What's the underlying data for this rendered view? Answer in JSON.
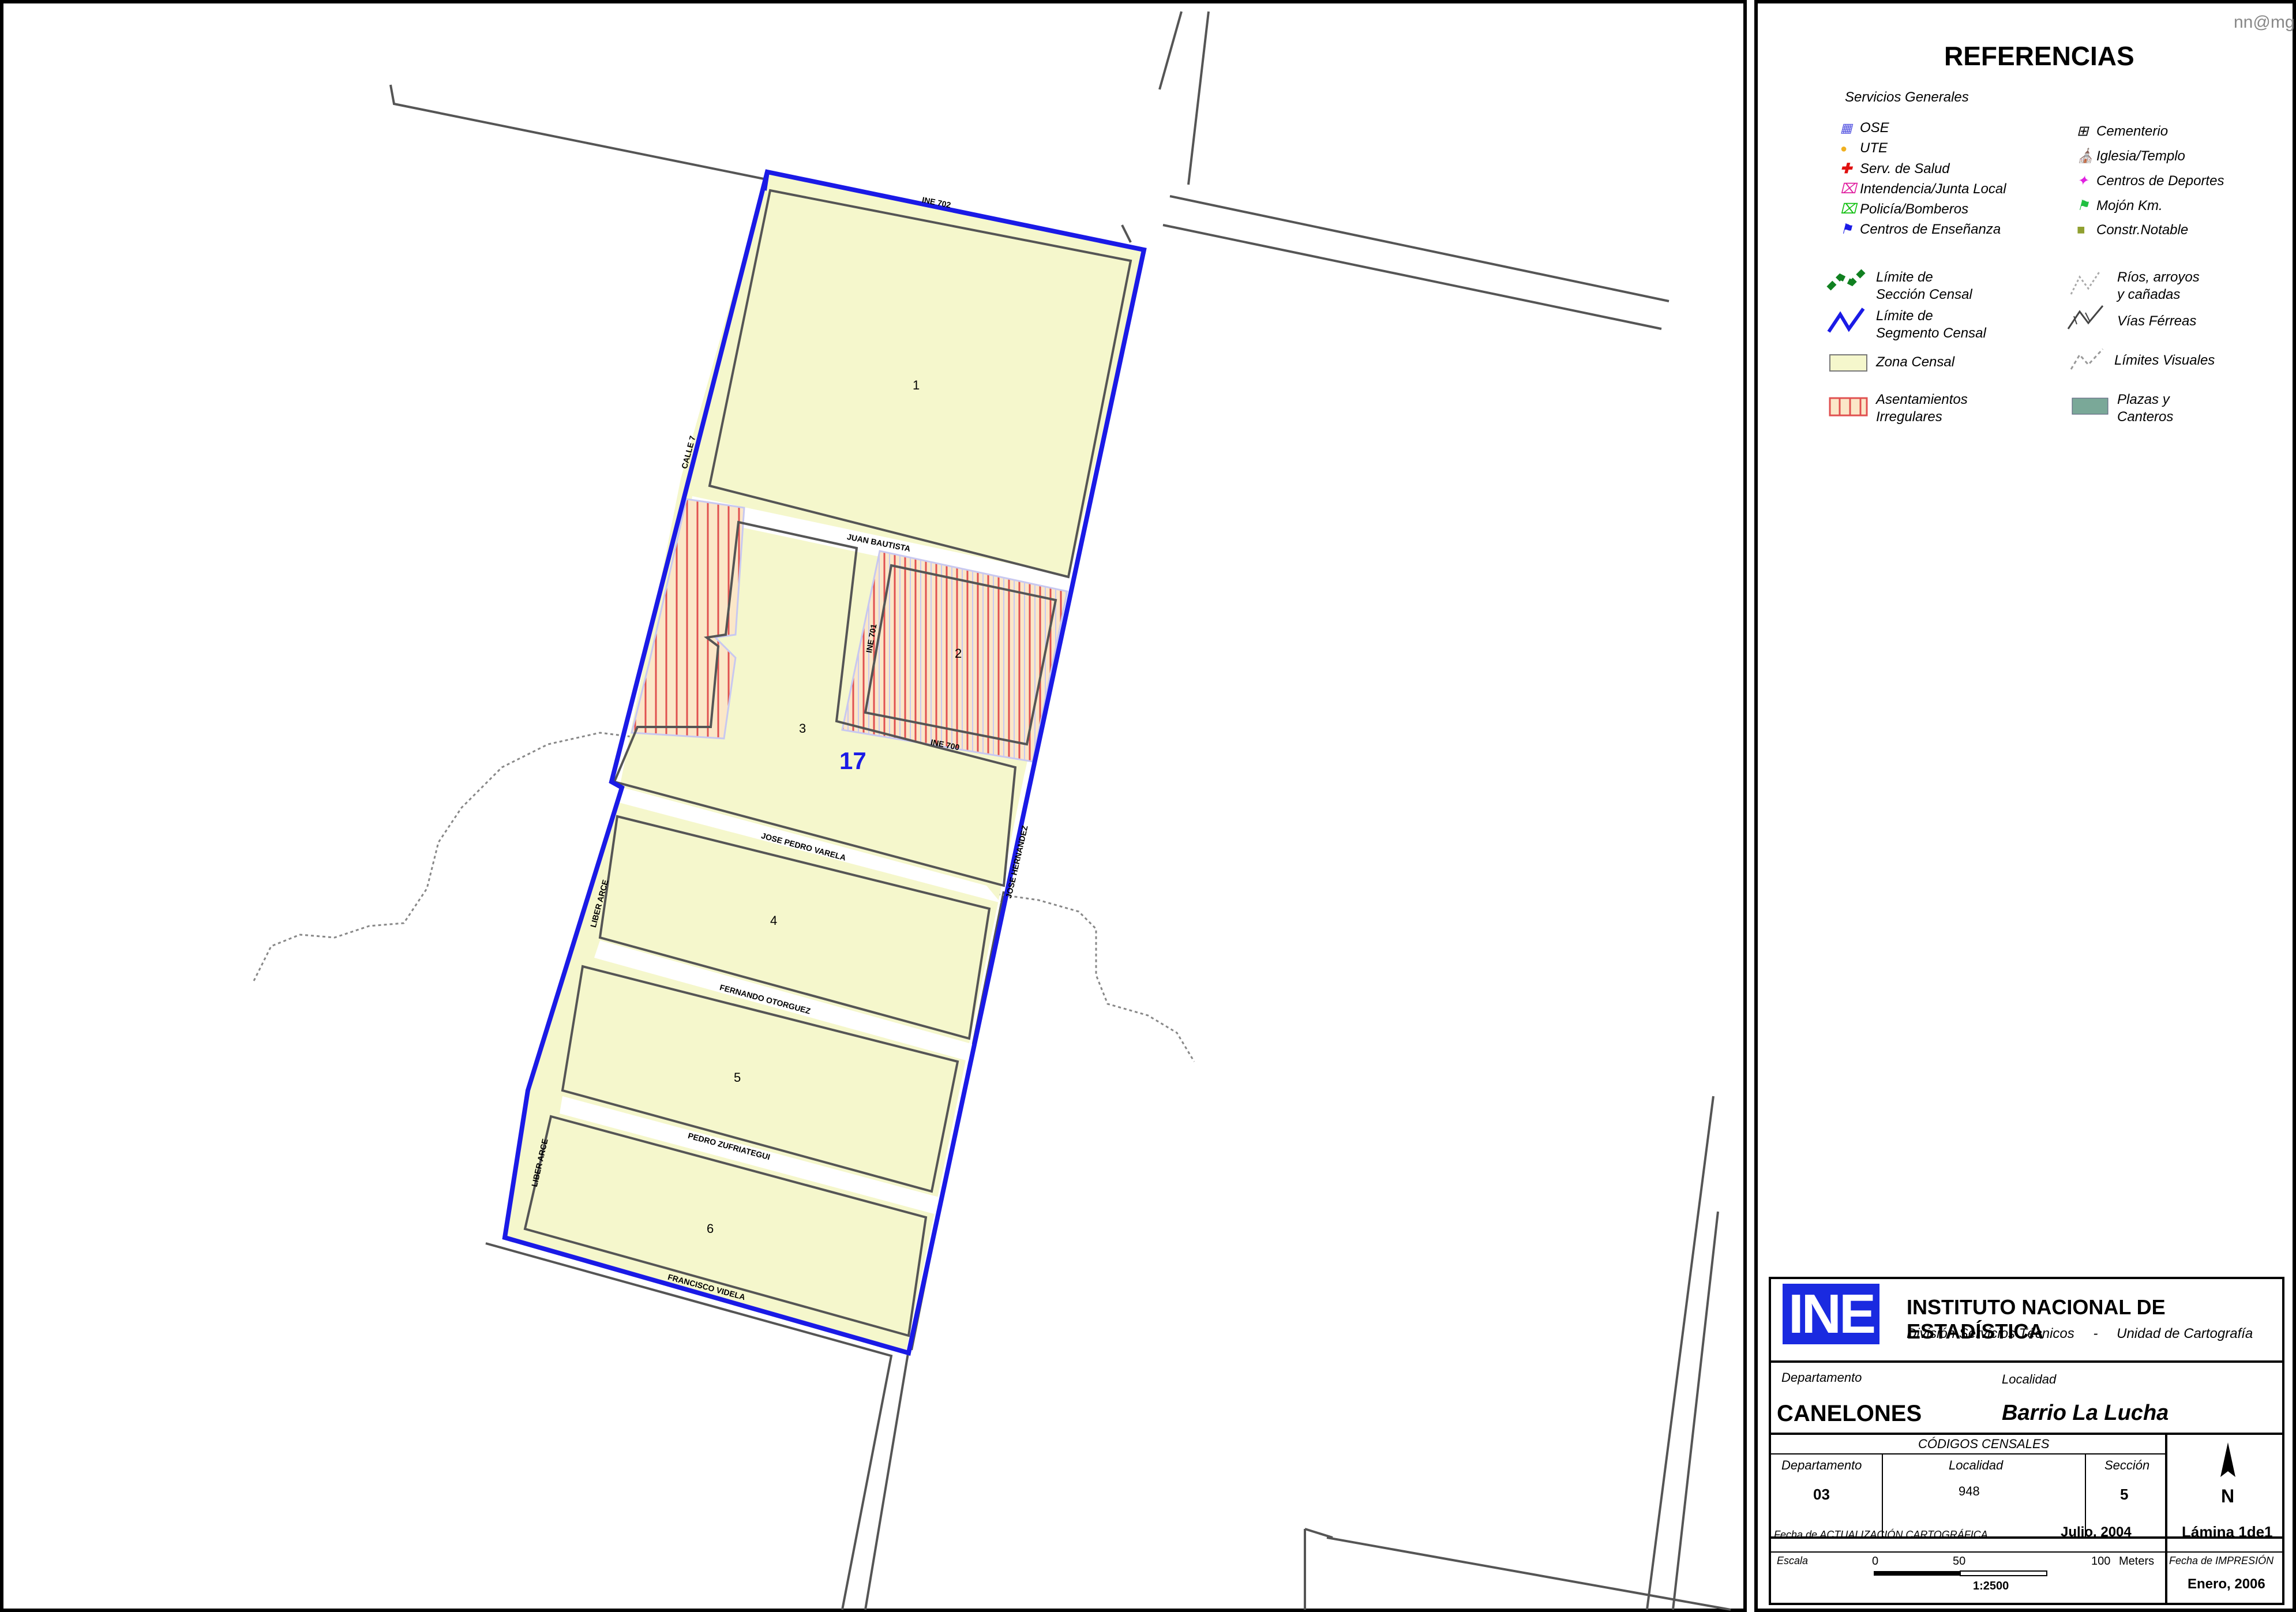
{
  "signature": "nn@mg",
  "map": {
    "segment_number": "17",
    "zones": [
      {
        "id": "1",
        "label": "1"
      },
      {
        "id": "2",
        "label": "2"
      },
      {
        "id": "3",
        "label": "3"
      },
      {
        "id": "4",
        "label": "4"
      },
      {
        "id": "5",
        "label": "5"
      },
      {
        "id": "6",
        "label": "6"
      }
    ],
    "streets": {
      "ine702": "INE 702",
      "calle7": "CALLE 7",
      "juan_bautista": "JUAN BAUTISTA",
      "ine701": "INE 701",
      "ine700": "INE 700",
      "jose_hernandez": "JOSE HERNANDEZ",
      "jose_pedro_varela": "JOSE PEDRO VARELA",
      "liber_arce_1": "LIBER ARCE",
      "fernando_otorguez": "FERNANDO OTORGUEZ",
      "pedro_zufriategui": "PEDRO ZUFRIATEGUI",
      "liber_arce_2": "LIBER ARCE",
      "francisco_videla": "FRANCISCO VIDELA"
    },
    "colors": {
      "zone_fill": "#f5f7cc",
      "segment_boundary": "#1a1ae6",
      "street_line": "#555555",
      "irregular_hatch": "#e05050",
      "river": "#888888"
    }
  },
  "legend": {
    "title": "REFERENCIAS",
    "services_heading": "Servicios Generales",
    "services_left": [
      "OSE",
      "UTE",
      "Serv. de Salud",
      "Intendencia/Junta Local",
      "Policía/Bomberos",
      "Centros de Enseñanza"
    ],
    "services_right": [
      "Cementerio",
      "Iglesia/Templo",
      "Centros de Deportes",
      "Mojón Km.",
      "Constr.Notable"
    ],
    "items_left": [
      {
        "line1": "Límite de",
        "line2": "Sección Censal"
      },
      {
        "line1": "Límite de",
        "line2": "Segmento Censal"
      },
      {
        "line1": "Zona Censal",
        "line2": ""
      },
      {
        "line1": "Asentamientos",
        "line2": "Irregulares"
      }
    ],
    "items_right": [
      {
        "line1": "Ríos, arroyos",
        "line2": "y cañadas"
      },
      {
        "line1": "Vías Férreas",
        "line2": ""
      },
      {
        "line1": "Límites  Visuales",
        "line2": ""
      },
      {
        "line1": "Plazas y",
        "line2": "Canteros"
      }
    ]
  },
  "titleblock": {
    "logo": "INE",
    "institute": "INSTITUTO NACIONAL DE ESTADÍSTICA",
    "division": "División Servicios Técnicos",
    "separator": "-",
    "unit": "Unidad de Cartografía",
    "dept_label": "Departamento",
    "locality_label": "Localidad",
    "dept_value": "CANELONES",
    "locality_value": "Barrio La Lucha",
    "codes_title": "CÓDIGOS CENSALES",
    "code_dept_label": "Departamento",
    "code_loc_label": "Localidad",
    "code_sec_label": "Sección",
    "code_dept": "03",
    "code_loc": "948",
    "code_sec": "5",
    "north": "N",
    "update_label": "Fecha de ACTUALIZACIÓN CARTOGRÁFICA",
    "update_date": "Julio, 2004",
    "sheet": "Lámina 1de1",
    "scale_label": "Escala",
    "scale_0": "0",
    "scale_50": "50",
    "scale_100": "100",
    "scale_unit": "Meters",
    "scale_ratio": "1:2500",
    "print_label": "Fecha de IMPRESIÓN",
    "print_date": "Enero, 2006"
  }
}
